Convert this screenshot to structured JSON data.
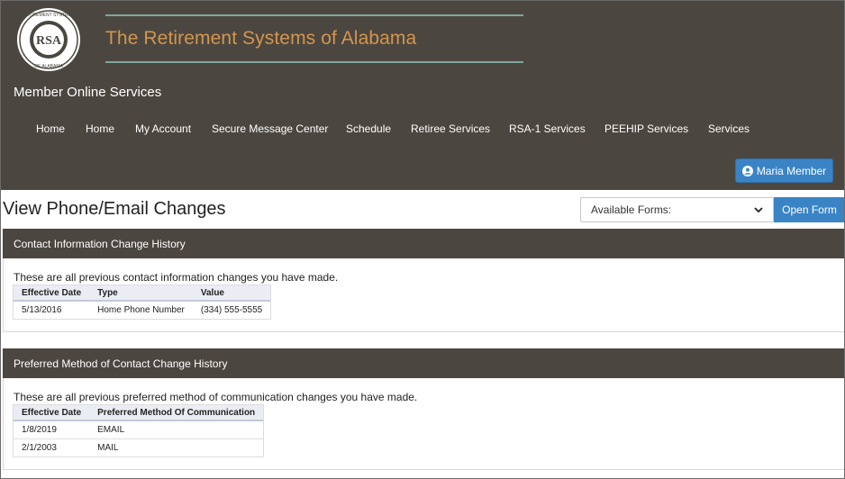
{
  "header": {
    "org_title": "The Retirement Systems of Alabama",
    "logo_text": {
      "outer_top": "THE RETIREMENT SYSTEMS",
      "outer_bottom": "OF ALABAMA",
      "center": "RSA"
    },
    "app_title": "Member Online Services"
  },
  "nav": {
    "items": [
      {
        "label": "Home"
      },
      {
        "label": "Home"
      },
      {
        "label": "My Account"
      },
      {
        "label": "Secure Message Center"
      },
      {
        "label": "Schedule"
      },
      {
        "label": "Retiree Services"
      },
      {
        "label": "RSA-1 Services"
      },
      {
        "label": "PEEHIP Services"
      },
      {
        "label": "Services"
      }
    ]
  },
  "user": {
    "label": "Maria Member",
    "icon": "user-circle-icon"
  },
  "page": {
    "title": "View Phone/Email Changes",
    "forms_select": {
      "selected": "Available Forms:"
    },
    "open_form_label": "Open Form"
  },
  "contact_history": {
    "heading": "Contact Information Change History",
    "description": "These are all previous contact information changes you have made.",
    "columns": [
      "Effective Date",
      "Type",
      "Value"
    ],
    "rows": [
      [
        "5/13/2016",
        "Home Phone Number",
        "(334) 555-5555"
      ]
    ]
  },
  "preferred_history": {
    "heading": "Preferred Method of Contact Change History",
    "description": "These are all previous preferred method of communication changes you have made.",
    "columns": [
      "Effective Date",
      "Preferred Method Of Communication"
    ],
    "rows": [
      [
        "1/8/2019",
        "EMAIL"
      ],
      [
        "2/1/2003",
        "MAIL"
      ]
    ]
  },
  "colors": {
    "header_bg": "#4b4740",
    "accent_orange": "#d4954e",
    "accent_line": "#7fa69c",
    "button_blue": "#3a84c6"
  }
}
